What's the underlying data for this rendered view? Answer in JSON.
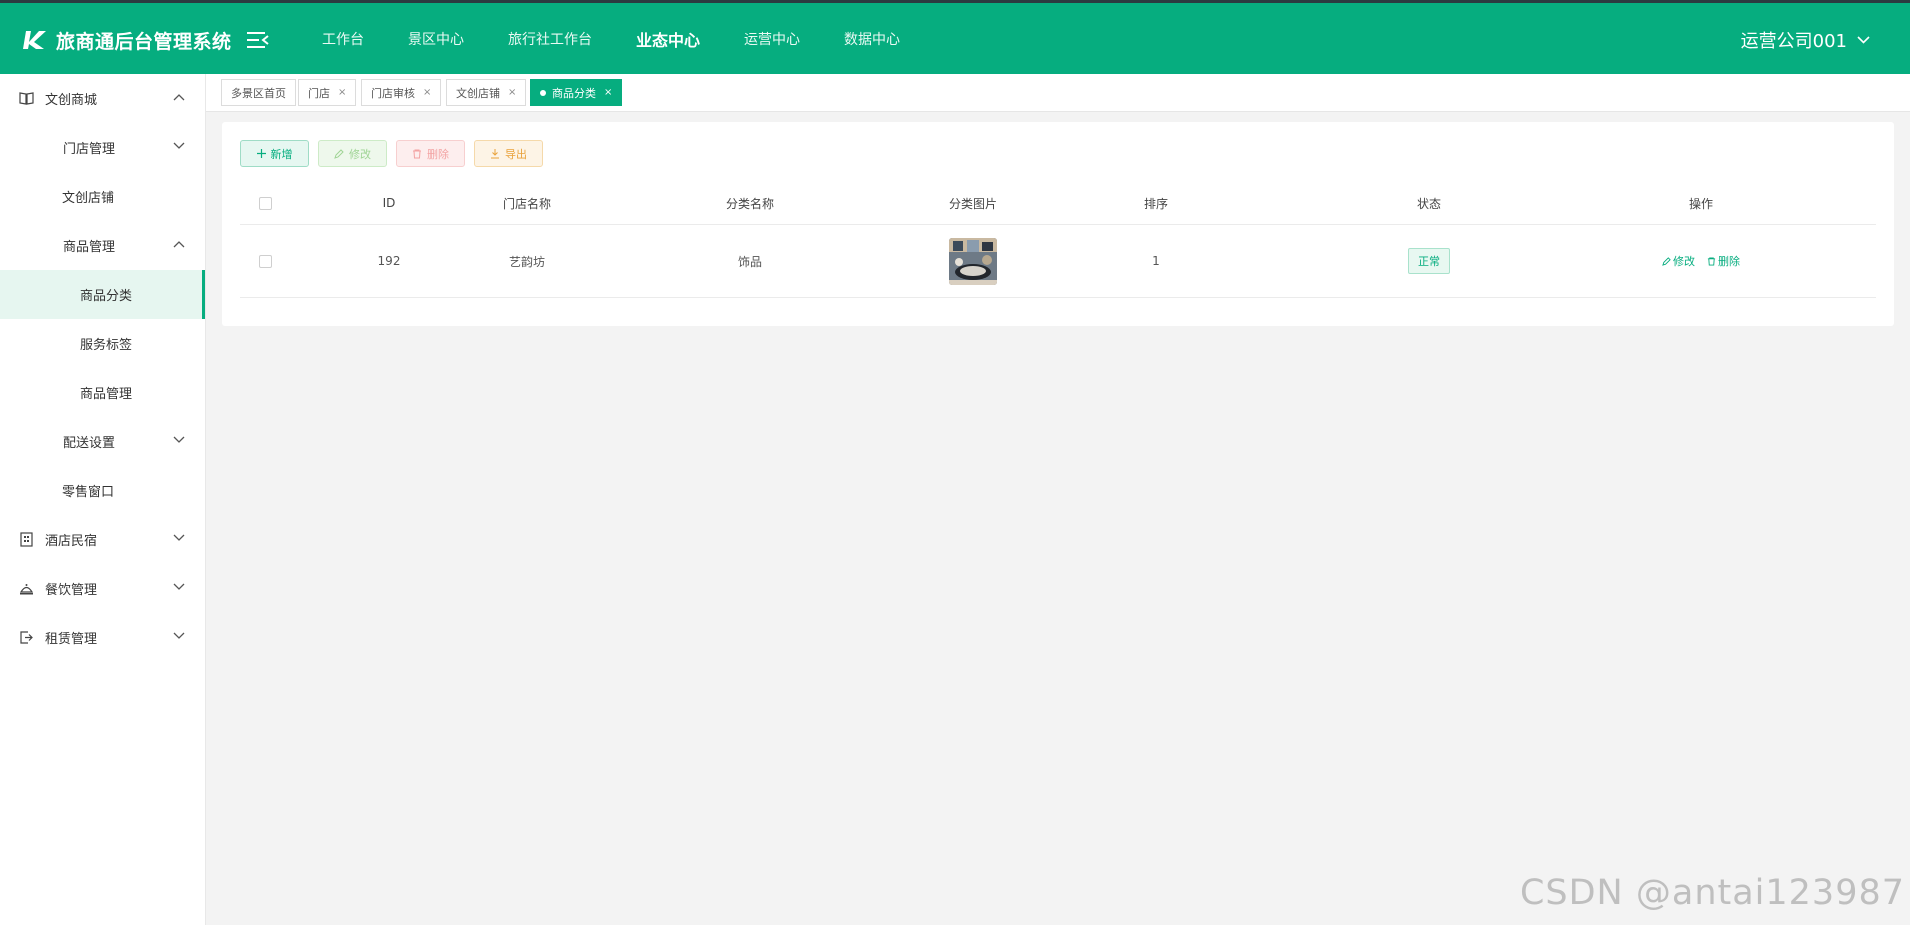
{
  "header": {
    "app_title": "旅商通后台管理系统",
    "nav": [
      "工作台",
      "景区中心",
      "旅行社工作台",
      "业态中心",
      "运营中心",
      "数据中心"
    ],
    "active_nav": "业态中心",
    "user": "运营公司001"
  },
  "sidebar": {
    "items": [
      {
        "label": "文创商城",
        "icon": "book-icon",
        "expanded": true
      },
      {
        "label": "门店管理",
        "expanded": false
      },
      {
        "label": "文创店铺"
      },
      {
        "label": "商品管理",
        "expanded": true
      },
      {
        "label": "商品分类",
        "selected": true
      },
      {
        "label": "服务标签"
      },
      {
        "label": "商品管理"
      },
      {
        "label": "配送设置",
        "expanded": false
      },
      {
        "label": "零售窗口"
      },
      {
        "label": "酒店民宿",
        "icon": "building-icon",
        "expanded": false
      },
      {
        "label": "餐饮管理",
        "icon": "dining-icon",
        "expanded": false
      },
      {
        "label": "租赁管理",
        "icon": "logout-icon",
        "expanded": false
      }
    ]
  },
  "tabs": [
    {
      "label": "多景区首页",
      "closable": false
    },
    {
      "label": "门店",
      "closable": true
    },
    {
      "label": "门店审核",
      "closable": true
    },
    {
      "label": "文创店铺",
      "closable": true
    },
    {
      "label": "商品分类",
      "closable": true,
      "active": true
    }
  ],
  "toolbar": {
    "add": "新增",
    "edit": "修改",
    "delete": "删除",
    "export": "导出"
  },
  "table": {
    "columns": [
      "ID",
      "门店名称",
      "分类名称",
      "分类图片",
      "排序",
      "状态",
      "操作"
    ],
    "rows": [
      {
        "id": "192",
        "store": "艺韵坊",
        "category": "饰品",
        "sort": "1",
        "status": "正常",
        "ops": [
          "修改",
          "删除"
        ]
      }
    ]
  },
  "watermark": "CSDN @antai123987",
  "colors": {
    "primary": "#06ad7f",
    "header_top_border": "#2b3a40",
    "background": "#f3f3f3"
  }
}
